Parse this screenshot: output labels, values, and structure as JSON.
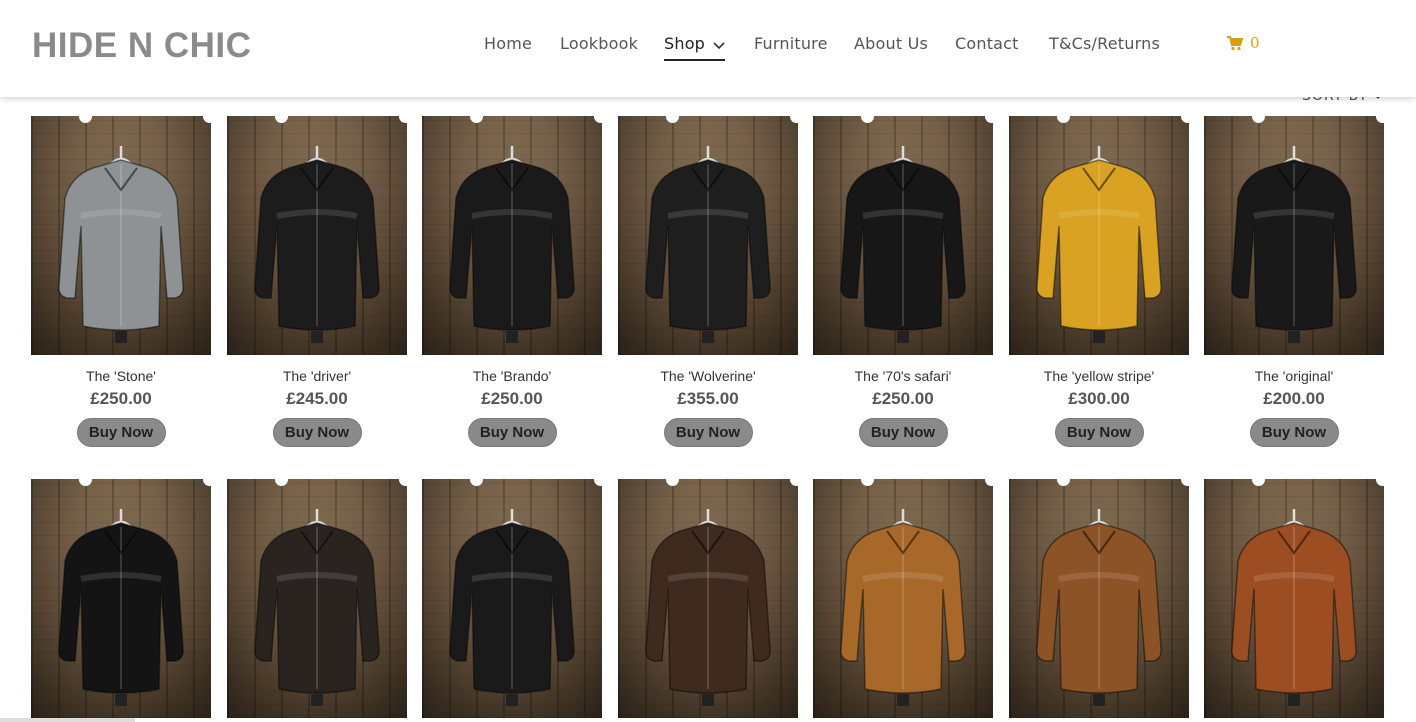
{
  "brand": "HIDE N CHIC",
  "nav": {
    "items": [
      {
        "label": "Home"
      },
      {
        "label": "Lookbook"
      },
      {
        "label": "Shop"
      },
      {
        "label": "Furniture"
      },
      {
        "label": "About Us"
      },
      {
        "label": "Contact"
      },
      {
        "label": "T&Cs/Returns"
      }
    ],
    "active": "Shop"
  },
  "cart": {
    "count": "0",
    "icon": "cart-icon",
    "color": "#d4a010"
  },
  "sort": {
    "label": "SORT BY"
  },
  "buy_label": "Buy Now",
  "colors": {
    "button_bg": "#8a8a8a",
    "logo": "#8a8a8a",
    "wood": "#6b5640"
  },
  "products": [
    {
      "name": "The 'Stone'",
      "price": "£250.00",
      "color": "#8e9295"
    },
    {
      "name": "The 'driver'",
      "price": "£245.00",
      "color": "#1c1c1c"
    },
    {
      "name": "The 'Brando'",
      "price": "£250.00",
      "color": "#1a1a1a"
    },
    {
      "name": "The 'Wolverine'",
      "price": "£355.00",
      "color": "#1e1e1e"
    },
    {
      "name": "The '70's safari'",
      "price": "£250.00",
      "color": "#171717"
    },
    {
      "name": "The 'yellow stripe'",
      "price": "£300.00",
      "color": "#d9a222"
    },
    {
      "name": "The 'original'",
      "price": "£200.00",
      "color": "#191919"
    },
    {
      "color": "#141414"
    },
    {
      "color": "#2a2420"
    },
    {
      "color": "#1a1a1a"
    },
    {
      "color": "#3e2a1e"
    },
    {
      "color": "#a8682a"
    },
    {
      "color": "#8c5326"
    },
    {
      "color": "#9c4d22"
    }
  ]
}
